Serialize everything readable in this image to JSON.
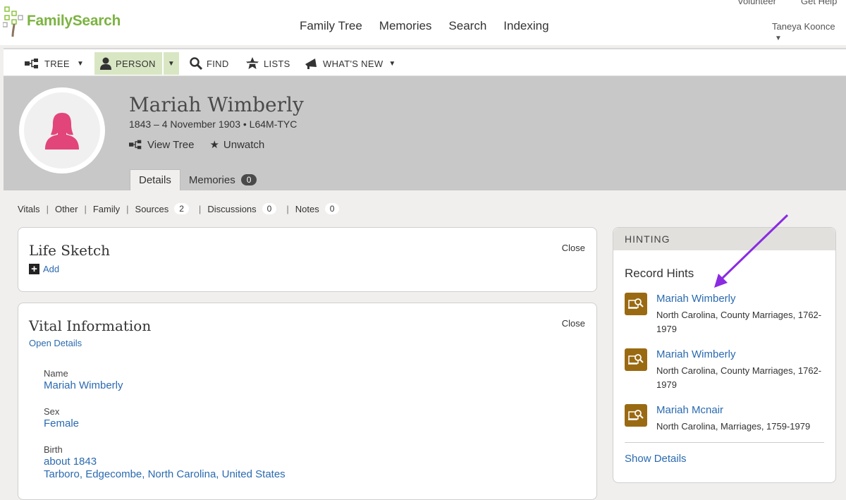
{
  "header": {
    "logo_text": "FamilySearch",
    "nav": [
      "Family Tree",
      "Memories",
      "Search",
      "Indexing"
    ],
    "util_links": [
      "Volunteer",
      "Get Help"
    ],
    "user_name": "Taneya Koonce"
  },
  "toolbar": {
    "tree_label": "TREE",
    "person_label": "PERSON",
    "find_label": "FIND",
    "lists_label": "LISTS",
    "whats_new_label": "WHAT'S NEW"
  },
  "person": {
    "name": "Mariah Wimberly",
    "dates_id": "1843 – 4 November 1903 • L64M-TYC",
    "view_tree_label": "View Tree",
    "unwatch_label": "Unwatch"
  },
  "tabs": {
    "details_label": "Details",
    "memories_label": "Memories",
    "memories_count": "0"
  },
  "subnav": {
    "vitals": "Vitals",
    "other": "Other",
    "family": "Family",
    "sources": "Sources",
    "sources_count": "2",
    "discussions": "Discussions",
    "discussions_count": "0",
    "notes": "Notes",
    "notes_count": "0"
  },
  "life_sketch": {
    "title": "Life Sketch",
    "close_label": "Close",
    "add_label": "Add"
  },
  "vital_info": {
    "title": "Vital Information",
    "close_label": "Close",
    "open_details_label": "Open Details",
    "name_label": "Name",
    "name_value": "Mariah Wimberly",
    "sex_label": "Sex",
    "sex_value": "Female",
    "birth_label": "Birth",
    "birth_date": "about 1843",
    "birth_place": "Tarboro, Edgecombe, North Carolina, United States"
  },
  "hinting": {
    "header": "HINTING",
    "subtitle": "Record Hints",
    "hints": [
      {
        "name": "Mariah Wimberly",
        "desc": "North Carolina, County Marriages, 1762-1979"
      },
      {
        "name": "Mariah Wimberly",
        "desc": "North Carolina, County Marriages, 1762-1979"
      },
      {
        "name": "Mariah Mcnair",
        "desc": "North Carolina, Marriages, 1759-1979"
      }
    ],
    "show_details_label": "Show Details"
  },
  "colors": {
    "brand_green": "#8cc43f",
    "link_blue": "#2a6ab0",
    "avatar_pink": "#e2457a",
    "hint_icon_brown": "#9a6a12",
    "annotation_arrow": "#8a2be2"
  }
}
